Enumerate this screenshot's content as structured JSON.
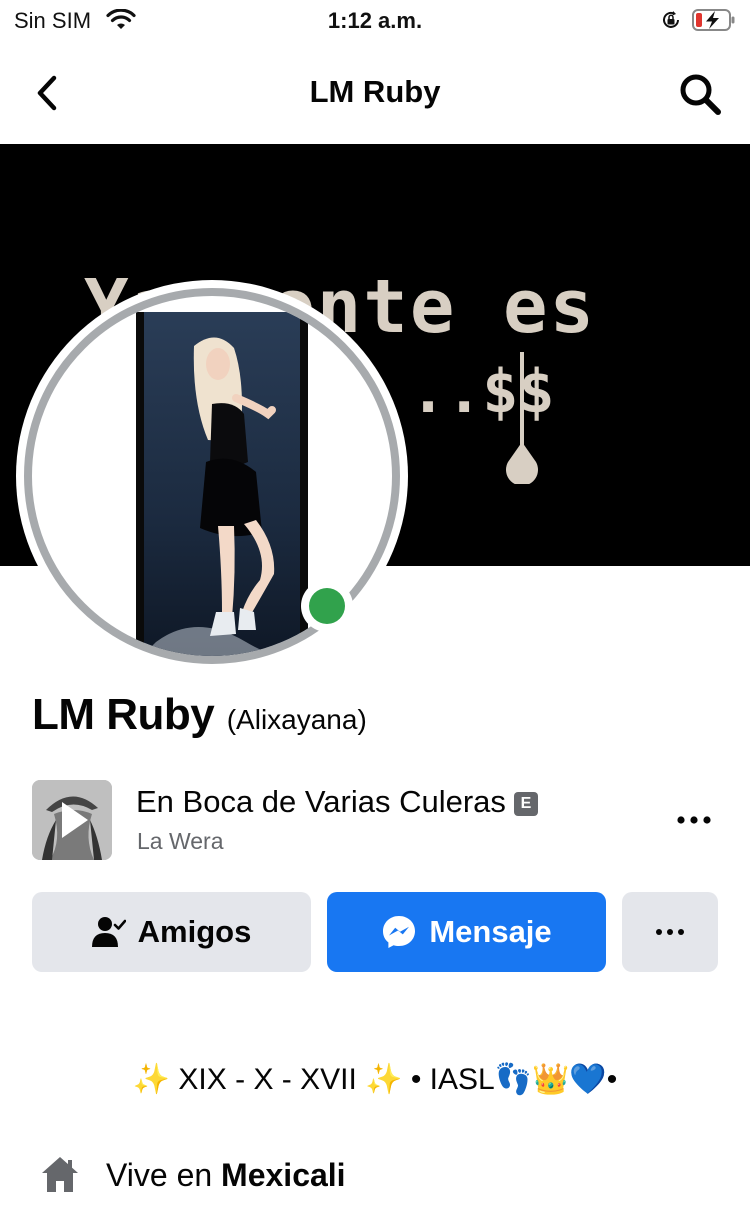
{
  "status_bar": {
    "carrier": "Sin SIM",
    "time": "1:12 a.m."
  },
  "nav": {
    "title": "LM Ruby"
  },
  "cover": {
    "text_line1": "Ya  mente es",
    "text_line2": "..$$"
  },
  "profile": {
    "name": "LM Ruby",
    "alternate_name": "(Alixayana)",
    "online": true
  },
  "music": {
    "title": "En Boca de Varias Culeras",
    "explicit_badge": "E",
    "artist": "La Wera"
  },
  "actions": {
    "friends_label": "Amigos",
    "message_label": "Mensaje"
  },
  "bio": "✨ XIX - X - XVII ✨ • IASL👣👑💙•",
  "location": {
    "prefix": "Vive en ",
    "city": "Mexicali"
  },
  "colors": {
    "primary_blue": "#1877f2",
    "button_gray": "#e4e6eb",
    "online_green": "#31a24c",
    "secondary_text": "#65676b"
  }
}
